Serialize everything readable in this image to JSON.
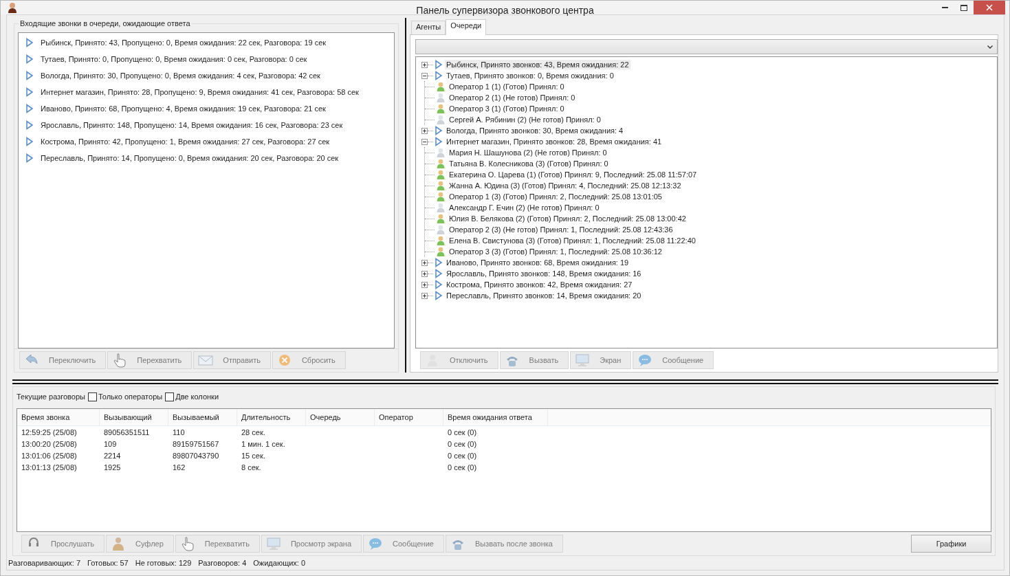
{
  "window": {
    "title": "Панель супервизора звонкового центра"
  },
  "incoming_panel": {
    "title": "Входящие звонки в очереди, ожидающие ответа",
    "items": [
      {
        "text": "Рыбинск, Принято: 43, Пропущено: 0, Время ожидания: 22 сек, Разговора: 19 сек"
      },
      {
        "text": "Тутаев, Принято: 0, Пропущено: 0, Время ожидания: 0 сек, Разговора: 0 сек"
      },
      {
        "text": "Вологда, Принято: 30, Пропущено: 0, Время ожидания: 4 сек, Разговора: 42 сек"
      },
      {
        "text": "Интернет магазин, Принято: 28, Пропущено: 9, Время ожидания: 41 сек, Разговора: 58 сек"
      },
      {
        "text": "Иваново, Принято: 68, Пропущено: 4, Время ожидания: 19 сек, Разговора: 21 сек"
      },
      {
        "text": "Ярославль, Принято: 148, Пропущено: 14, Время ожидания: 16 сек, Разговора: 23 сек"
      },
      {
        "text": "Кострома, Принято: 42, Пропущено: 1, Время ожидания: 27 сек, Разговора: 27 сек"
      },
      {
        "text": "Переславль, Принято: 14, Пропущено: 0, Время ожидания: 20 сек, Разговора: 20 сек"
      }
    ],
    "buttons": [
      {
        "label": "Переключить",
        "kind": "arrow",
        "disabled": true
      },
      {
        "label": "Перехватить",
        "kind": "hand",
        "disabled": true
      },
      {
        "label": "Отправить",
        "kind": "envelope",
        "disabled": true
      },
      {
        "label": "Сбросить",
        "kind": "cancel",
        "disabled": true
      }
    ]
  },
  "tabs": [
    {
      "label": "Агенты",
      "selected": false
    },
    {
      "label": "Очереди",
      "selected": true
    }
  ],
  "queue_tree": {
    "items": [
      {
        "text": "Рыбинск, Принято звонков: 43, Время ожидания: 22",
        "expanded": false,
        "selected": true
      },
      {
        "text": "Тутаев, Принято звонков: 0, Время ожидания: 0",
        "expanded": true,
        "selected": false,
        "children": [
          {
            "text": "Оператор 1 (1) (Готов) Принял: 0",
            "ready": true
          },
          {
            "text": "Оператор 2 (1) (Не готов) Принял: 0",
            "ready": false
          },
          {
            "text": "Оператор 3 (1) (Готов) Принял: 0",
            "ready": true
          },
          {
            "text": "Сергей А. Рябинин (2) (Не готов) Принял: 0",
            "ready": false
          }
        ]
      },
      {
        "text": "Вологда, Принято звонков: 30, Время ожидания: 4",
        "expanded": false,
        "selected": false
      },
      {
        "text": "Интернет магазин, Принято звонков: 28, Время ожидания: 41",
        "expanded": true,
        "selected": false,
        "children": [
          {
            "text": "Мария Н. Шашунова (2) (Не готов) Принял: 0",
            "ready": false
          },
          {
            "text": "Татьяна В. Колесникова (3) (Готов) Принял: 0",
            "ready": true
          },
          {
            "text": "Екатерина О. Царева (1) (Готов) Принял: 9, Последний: 25.08 11:57:07",
            "ready": true
          },
          {
            "text": "Жанна А. Юдина (3) (Готов) Принял: 4, Последний: 25.08 12:13:32",
            "ready": true
          },
          {
            "text": "Оператор 1 (3) (Готов) Принял: 2, Последний: 25.08 13:01:05",
            "ready": true
          },
          {
            "text": "Александр Г. Ечин (2) (Не готов) Принял: 0",
            "ready": false
          },
          {
            "text": "Юлия В. Белякова (2) (Готов) Принял: 2, Последний: 25.08 13:00:42",
            "ready": true
          },
          {
            "text": "Оператор 2 (3) (Не готов) Принял: 1, Последний: 25.08 12:43:36",
            "ready": false
          },
          {
            "text": "Елена В. Свистунова (3) (Готов) Принял: 1, Последний: 25.08 11:22:40",
            "ready": true
          },
          {
            "text": "Оператор 3 (3) (Готов) Принял: 1, Последний: 25.08 10:36:12",
            "ready": true
          }
        ]
      },
      {
        "text": "Иваново, Принято звонков: 68, Время ожидания: 19",
        "expanded": false,
        "selected": false
      },
      {
        "text": "Ярославль, Принято звонков: 148, Время ожидания: 16",
        "expanded": false,
        "selected": false
      },
      {
        "text": "Кострома, Принято звонков: 42, Время ожидания: 27",
        "expanded": false,
        "selected": false
      },
      {
        "text": "Переславль, Принято звонков: 14, Время ожидания: 20",
        "expanded": false,
        "selected": false
      }
    ]
  },
  "queue_buttons": [
    {
      "label": "Отключить",
      "kind": "person",
      "disabled": true
    },
    {
      "label": "Вызвать",
      "kind": "phone",
      "disabled": true
    },
    {
      "label": "Экран",
      "kind": "monitor",
      "disabled": true
    },
    {
      "label": "Сообщение",
      "kind": "chat",
      "disabled": true
    }
  ],
  "current_calls": {
    "title": "Текущие разговоры",
    "options": [
      {
        "label": "Только операторы",
        "checked": false
      },
      {
        "label": "Две колонки",
        "checked": false
      }
    ],
    "table": {
      "columns": [
        "Время звонка",
        "Вызывающий",
        "Вызываемый",
        "Длительность",
        "Очередь",
        "Оператор",
        "Время ожидания ответа"
      ],
      "rows": [
        [
          "12:59:25 (25/08)",
          "89056351511",
          "110",
          "28 сек.",
          "",
          "",
          "0 сек (0)"
        ],
        [
          "13:00:20 (25/08)",
          "109",
          "89159751567",
          "1 мин. 1 сек.",
          "",
          "",
          "0 сек (0)"
        ],
        [
          "13:01:06 (25/08)",
          "2214",
          "89807043790",
          "15 сек.",
          "",
          "",
          "0 сек (0)"
        ],
        [
          "13:01:13 (25/08)",
          "1925",
          "162",
          "8 сек.",
          "",
          "",
          "0 сек (0)"
        ]
      ]
    },
    "buttons": [
      {
        "label": "Прослушать",
        "kind": "headset",
        "disabled": true
      },
      {
        "label": "Суфлер",
        "kind": "prompter",
        "disabled": true
      },
      {
        "label": "Перехватить",
        "kind": "hand",
        "disabled": true
      },
      {
        "label": "Просмотр экрана",
        "kind": "monitor",
        "disabled": true
      },
      {
        "label": "Сообщение",
        "kind": "chat",
        "disabled": true
      },
      {
        "label": "Вызвать после звонка",
        "kind": "phone",
        "disabled": true
      }
    ],
    "charts_button": {
      "label": "Графики",
      "disabled": false
    }
  },
  "status_bar": [
    "Разговаривающих: 7",
    "Готовых: 57",
    "Не готовых: 129",
    "Разговоров: 4",
    "Ожидающих: 0"
  ]
}
